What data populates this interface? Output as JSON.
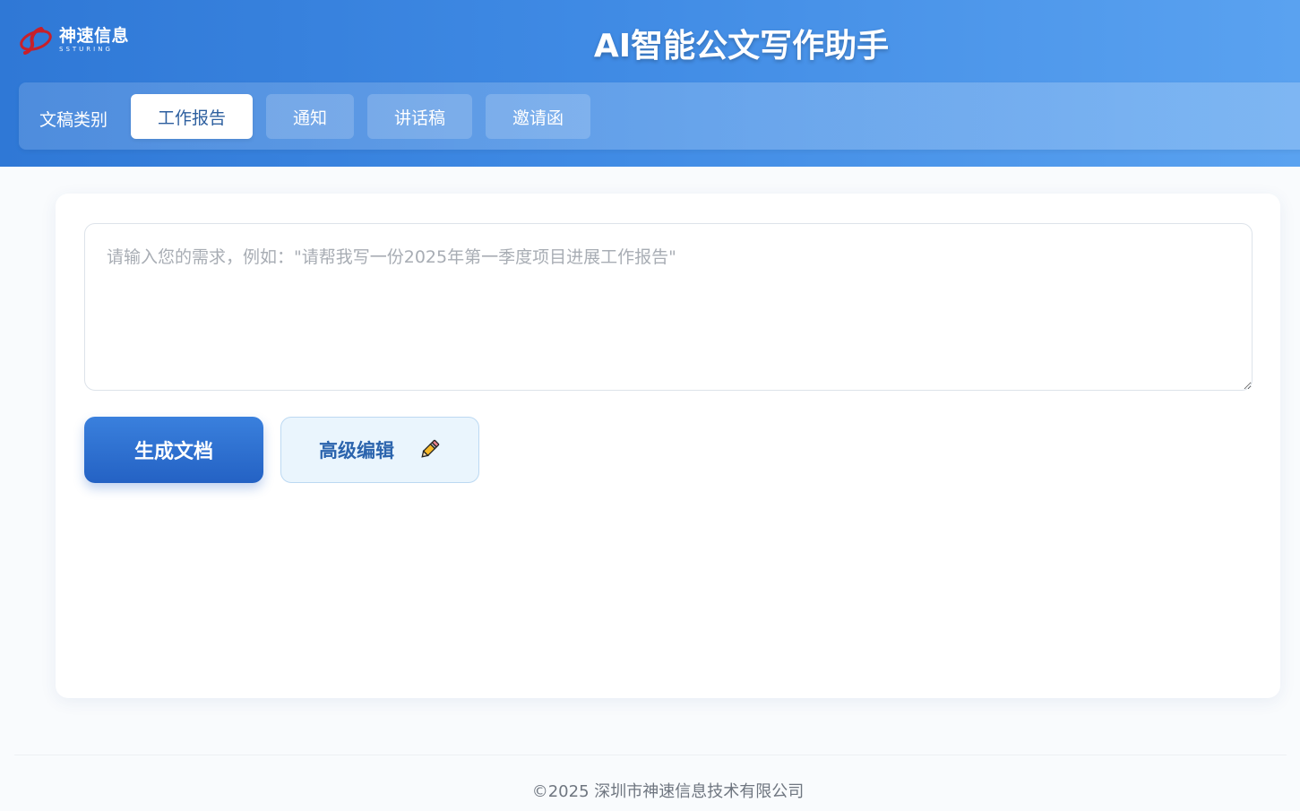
{
  "brand": {
    "name_cn": "神速信息",
    "name_en": "SSTURING",
    "logo_icon": "brand-logo-icon"
  },
  "header": {
    "title": "AI智能公文写作助手"
  },
  "categories": {
    "label": "文稿类别",
    "tabs": [
      {
        "label": "工作报告",
        "active": true
      },
      {
        "label": "通知",
        "active": false
      },
      {
        "label": "讲话稿",
        "active": false
      },
      {
        "label": "邀请函",
        "active": false
      }
    ]
  },
  "editor": {
    "value": "",
    "placeholder": "请输入您的需求，例如：\"请帮我写一份2025年第一季度项目进展工作报告\""
  },
  "actions": {
    "generate_label": "生成文档",
    "advanced_label": "高级编辑",
    "advanced_icon": "pencil-icon"
  },
  "footer": {
    "copyright": "©2025 深圳市神速信息技术有限公司"
  },
  "colors": {
    "header_start": "#2f78d6",
    "header_end": "#5aa2f0",
    "primary_button": "#2a6ccd",
    "secondary_button_bg": "#eaf5fd",
    "secondary_button_text": "#2b64ad"
  }
}
